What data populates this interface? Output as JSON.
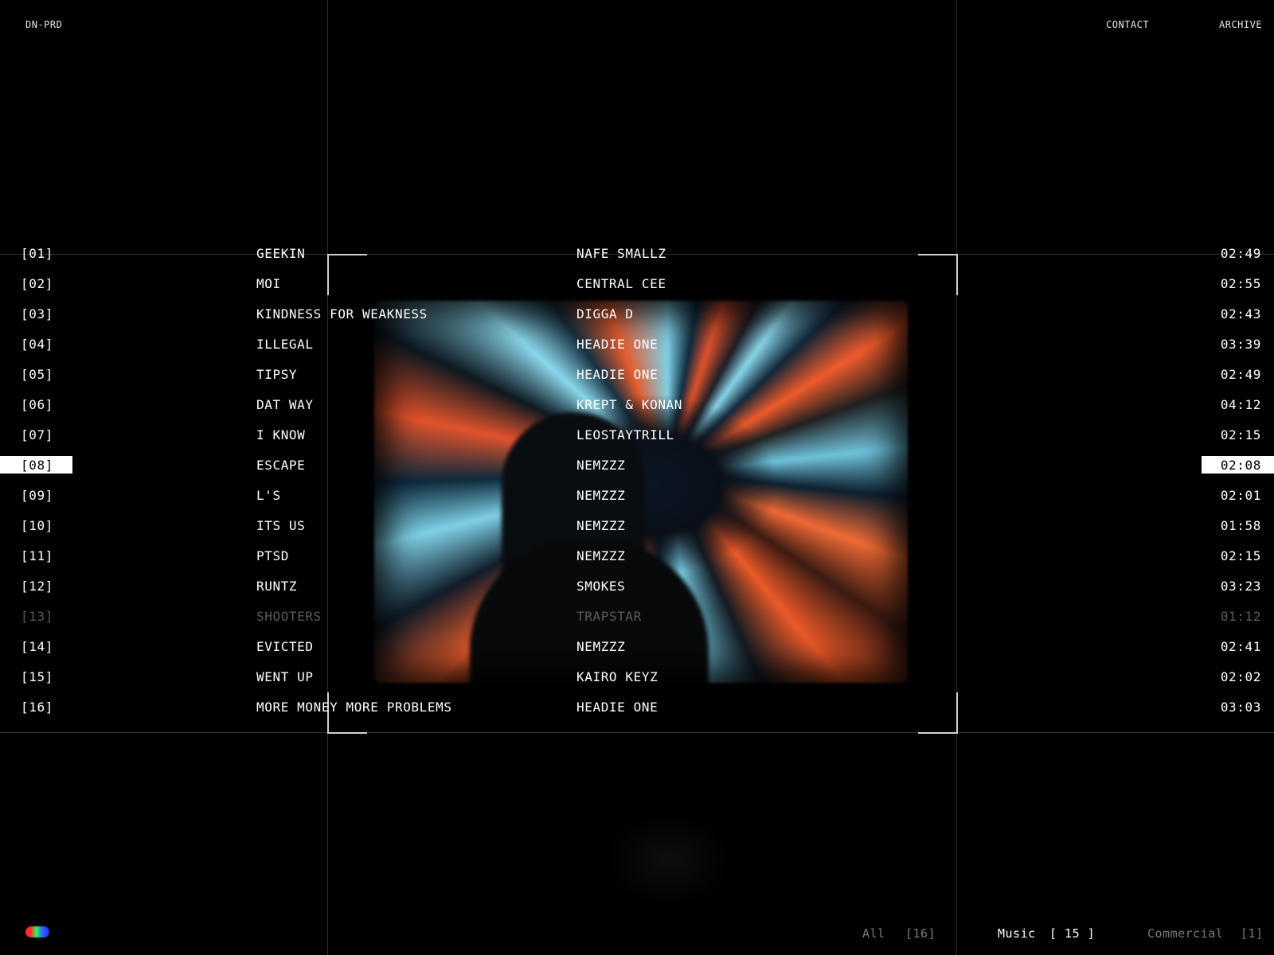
{
  "header": {
    "brand": "DN-PRD",
    "nav": [
      {
        "label": "CONTACT"
      },
      {
        "label": "ARCHIVE"
      }
    ]
  },
  "tracks": [
    {
      "num": "[01]",
      "title": "GEEKIN",
      "artist": "NAFE SMALLZ",
      "duration": "02:49"
    },
    {
      "num": "[02]",
      "title": "MOI",
      "artist": "CENTRAL CEE",
      "duration": "02:55"
    },
    {
      "num": "[03]",
      "title": "KINDNESS FOR WEAKNESS",
      "artist": "DIGGA D",
      "duration": "02:43"
    },
    {
      "num": "[04]",
      "title": "ILLEGAL",
      "artist": "HEADIE ONE",
      "duration": "03:39"
    },
    {
      "num": "[05]",
      "title": "TIPSY",
      "artist": "HEADIE ONE",
      "duration": "02:49"
    },
    {
      "num": "[06]",
      "title": "DAT WAY",
      "artist": "KREPT & KONAN",
      "duration": "04:12"
    },
    {
      "num": "[07]",
      "title": "I KNOW",
      "artist": "LEOSTAYTRILL",
      "duration": "02:15"
    },
    {
      "num": "[08]",
      "title": "ESCAPE",
      "artist": "NEMZZZ",
      "duration": "02:08"
    },
    {
      "num": "[09]",
      "title": "L'S",
      "artist": "NEMZZZ",
      "duration": "02:01"
    },
    {
      "num": "[10]",
      "title": "ITS US",
      "artist": "NEMZZZ",
      "duration": "01:58"
    },
    {
      "num": "[11]",
      "title": "PTSD",
      "artist": "NEMZZZ",
      "duration": "02:15"
    },
    {
      "num": "[12]",
      "title": "RUNTZ",
      "artist": "SMOKES",
      "duration": "03:23"
    },
    {
      "num": "[13]",
      "title": "SHOOTERS",
      "artist": "TRAPSTAR",
      "duration": "01:12"
    },
    {
      "num": "[14]",
      "title": "EVICTED",
      "artist": "NEMZZZ",
      "duration": "02:41"
    },
    {
      "num": "[15]",
      "title": "WENT UP",
      "artist": "KAIRO KEYZ",
      "duration": "02:02"
    },
    {
      "num": "[16]",
      "title": "MORE MONEY MORE PROBLEMS",
      "artist": "HEADIE ONE",
      "duration": "03:03"
    }
  ],
  "active_track": "[08]",
  "dimmed_track": "[13]",
  "filters": [
    {
      "label": "All",
      "count": "[16]",
      "active": false
    },
    {
      "label": "Music",
      "count": "[ 15 ]",
      "active": true
    },
    {
      "label": "Commercial",
      "count": "[1]",
      "active": false
    }
  ],
  "colors": {
    "background": "#000000",
    "text": "#ffffff",
    "dim_text": "#5a5a5a",
    "highlight": "#ffffff"
  },
  "icons": {
    "logo": "rgb-dot-logo-icon"
  }
}
